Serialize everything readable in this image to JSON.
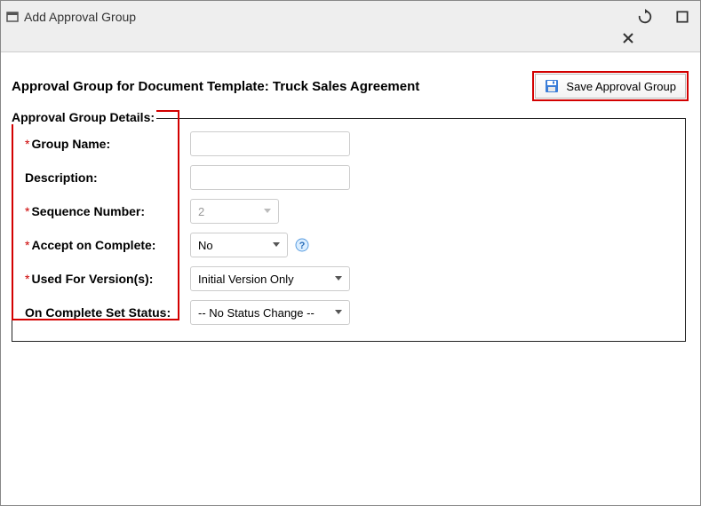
{
  "window": {
    "title": "Add Approval Group"
  },
  "page": {
    "title_prefix": "Approval Group for Document Template: ",
    "title_doc": "Truck Sales Agreement",
    "save_button": "Save Approval Group"
  },
  "fieldset": {
    "legend": "Approval Group Details:"
  },
  "fields": {
    "group_name": {
      "label": "Group Name:",
      "value": ""
    },
    "description": {
      "label": "Description:",
      "value": ""
    },
    "sequence": {
      "label": "Sequence Number:",
      "value": "2"
    },
    "accept": {
      "label": "Accept on Complete:",
      "value": "No"
    },
    "used_for": {
      "label": "Used For Version(s):",
      "value": "Initial Version Only"
    },
    "on_complete": {
      "label": "On Complete Set Status:",
      "value": "-- No Status Change --"
    }
  }
}
